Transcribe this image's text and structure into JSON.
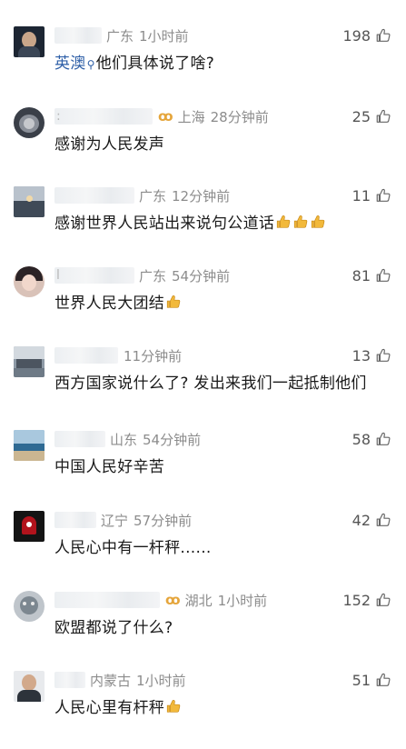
{
  "comments": [
    {
      "username_fragment": "",
      "location": "广东",
      "time": "1小时前",
      "likes": "198",
      "text_before": "",
      "mention": "英澳",
      "text_after": "他们具体说了啥?",
      "has_badge": false,
      "emoji_count": 0
    },
    {
      "username_fragment": "",
      "location": "上海",
      "time": "28分钟前",
      "likes": "25",
      "text_before": "感谢为人民发声",
      "mention": "",
      "text_after": "",
      "has_badge": true,
      "emoji_count": 0
    },
    {
      "username_fragment": "",
      "location": "广东",
      "time": "12分钟前",
      "likes": "11",
      "text_before": "感谢世界人民站出来说句公道话",
      "mention": "",
      "text_after": "",
      "has_badge": false,
      "emoji_count": 3
    },
    {
      "username_fragment": "",
      "location": "广东",
      "time": "54分钟前",
      "likes": "81",
      "text_before": "世界人民大团结",
      "mention": "",
      "text_after": "",
      "has_badge": false,
      "emoji_count": 1
    },
    {
      "username_fragment": "",
      "location": "",
      "time": "11分钟前",
      "likes": "13",
      "text_before": "西方国家说什么了? 发出来我们一起抵制他们",
      "mention": "",
      "text_after": "",
      "has_badge": false,
      "emoji_count": 0
    },
    {
      "username_fragment": "",
      "location": "山东",
      "time": "54分钟前",
      "likes": "58",
      "text_before": "中国人民好辛苦",
      "mention": "",
      "text_after": "",
      "has_badge": false,
      "emoji_count": 0
    },
    {
      "username_fragment": "",
      "location": "辽宁",
      "time": "57分钟前",
      "likes": "42",
      "text_before": "人民心中有一杆秤......",
      "mention": "",
      "text_after": "",
      "has_badge": false,
      "emoji_count": 0
    },
    {
      "username_fragment": "",
      "location": "湖北",
      "time": "1小时前",
      "likes": "152",
      "text_before": "欧盟都说了什么?",
      "mention": "",
      "text_after": "",
      "has_badge": true,
      "emoji_count": 0
    },
    {
      "username_fragment": "",
      "location": "内蒙古",
      "time": "1小时前",
      "likes": "51",
      "text_before": "人民心里有杆秤",
      "mention": "",
      "text_after": "",
      "has_badge": false,
      "emoji_count": 1
    }
  ],
  "icons": {
    "like": "thumbs-up-outline-icon",
    "emoji": "thumbs-up-emoji-icon",
    "search": "search-icon",
    "badge": "member-badge-icon"
  },
  "colors": {
    "mention": "#2e5fa7",
    "meta": "#8c8c8c",
    "badge": "#e5a53b",
    "emoji": "#f2b93b"
  }
}
